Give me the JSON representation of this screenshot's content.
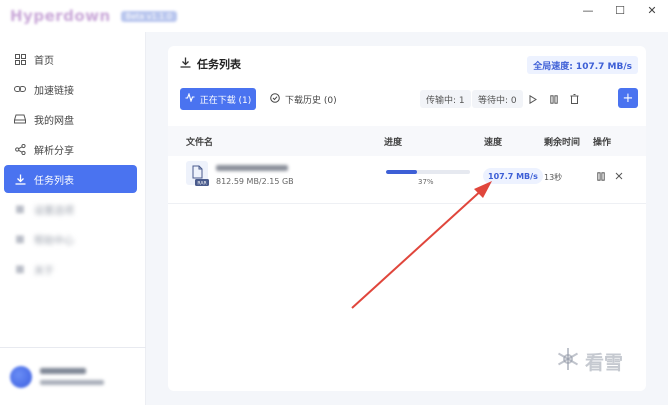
{
  "app": {
    "title": "Hyperdown",
    "version": "Beta v1.1.0"
  },
  "window": {
    "minimize": "—",
    "maximize": "☐",
    "close": "✕"
  },
  "sidebar": {
    "items": [
      {
        "label": "首页",
        "icon": "grid-icon"
      },
      {
        "label": "加速链接",
        "icon": "link-icon"
      },
      {
        "label": "我的网盘",
        "icon": "drive-icon"
      },
      {
        "label": "解析分享",
        "icon": "share-icon"
      },
      {
        "label": "任务列表",
        "icon": "download-icon",
        "active": true
      },
      {
        "label": "设置选项",
        "icon": "blurred-icon",
        "blurred": true
      },
      {
        "label": "帮助中心",
        "icon": "blurred-icon",
        "blurred": true
      },
      {
        "label": "关于",
        "icon": "blurred-icon",
        "blurred": true
      }
    ]
  },
  "panel": {
    "title": "任务列表",
    "global_speed": "全局速度: 107.7 MB/s",
    "tabs": {
      "downloading": "正在下载 (1)",
      "history": "下载历史 (0)"
    },
    "counters": {
      "transferring": "传输中: 1",
      "waiting": "等待中: 0"
    },
    "add": "+"
  },
  "table": {
    "headers": {
      "filename": "文件名",
      "progress": "进度",
      "speed": "速度",
      "remaining": "剩余时间",
      "actions": "操作"
    },
    "rows": [
      {
        "file_type": "RAR",
        "size": "812.59 MB/2.15 GB",
        "progress_percent": 37,
        "progress_label": "37%",
        "speed": "107.7 MB/s",
        "remaining": "13秒"
      }
    ]
  },
  "watermark": "看雪",
  "colors": {
    "accent": "#4a73f0",
    "arrow": "#e0463c"
  }
}
